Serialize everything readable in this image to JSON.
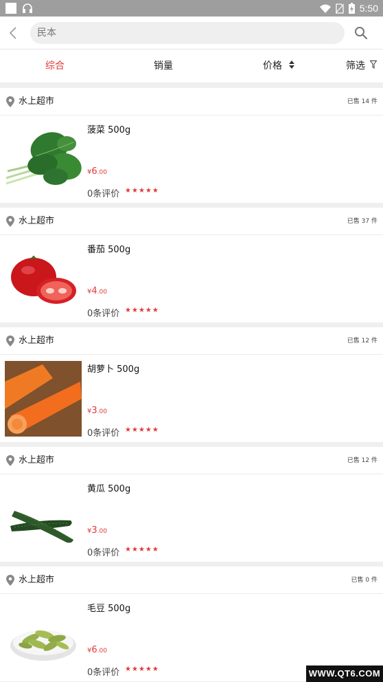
{
  "status_bar": {
    "time": "5:50"
  },
  "search": {
    "placeholder": "民本",
    "value": ""
  },
  "sort_tabs": {
    "comprehensive": "综合",
    "sales": "销量",
    "price": "价格",
    "filter": "筛选"
  },
  "colors": {
    "accent": "#e0393a",
    "background": "#efefef",
    "status_bar": "#9e9e9e"
  },
  "products": [
    {
      "shop": "水上超市",
      "sold": "已售 14 件",
      "name": "菠菜 500g",
      "currency": "¥",
      "price_int": "6",
      "price_dec": ".00",
      "reviews": "0条评价",
      "rating": 5,
      "image": "spinach"
    },
    {
      "shop": "水上超市",
      "sold": "已售 37 件",
      "name": "番茄 500g",
      "currency": "¥",
      "price_int": "4",
      "price_dec": ".00",
      "reviews": "0条评价",
      "rating": 5,
      "image": "tomato"
    },
    {
      "shop": "水上超市",
      "sold": "已售 12 件",
      "name": "胡萝卜 500g",
      "currency": "¥",
      "price_int": "3",
      "price_dec": ".00",
      "reviews": "0条评价",
      "rating": 5,
      "image": "carrot"
    },
    {
      "shop": "水上超市",
      "sold": "已售 12 件",
      "name": "黄瓜 500g",
      "currency": "¥",
      "price_int": "3",
      "price_dec": ".00",
      "reviews": "0条评价",
      "rating": 5,
      "image": "cucumber"
    },
    {
      "shop": "水上超市",
      "sold": "已售 0 件",
      "name": "毛豆 500g",
      "currency": "¥",
      "price_int": "6",
      "price_dec": ".00",
      "reviews": "0条评价",
      "rating": 5,
      "image": "edamame"
    }
  ],
  "watermark": "WWW.QT6.COM"
}
